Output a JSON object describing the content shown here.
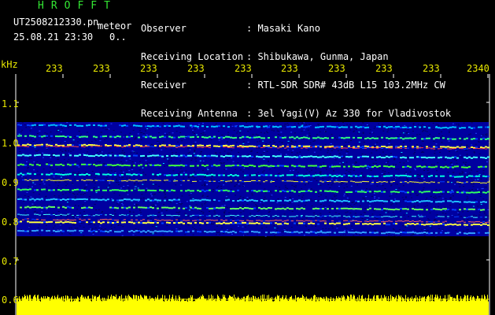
{
  "header": {
    "brand": "HROFFT",
    "filename": "UT2508212330.pn",
    "tag": "meteor",
    "datetime": "25.08.21 23:30",
    "count": "0..",
    "info_labels": [
      "Observer",
      "Receiving Location",
      "Receiver",
      "Receiving Antenna"
    ],
    "info_values": [
      ": Masaki Kano",
      ": Shibukawa, Gunma, Japan",
      ": RTL-SDR SDR# 43dB L15 103.2MHz CW",
      ": 3el Yagi(V) Az 330 for Vladivostok"
    ]
  },
  "axis": {
    "y_unit": "kHz",
    "y_ticks": [
      "1.1",
      "1.0",
      "0.9",
      "0.8",
      "0.7",
      "0.6"
    ],
    "x_ticks": [
      "233",
      "233",
      "233",
      "233",
      "233",
      "233",
      "233",
      "233",
      "233",
      "2340"
    ]
  },
  "colors": {
    "text_main": "#ffffff",
    "brand": "#33e633",
    "axis_label": "#e8e800",
    "background": "#000000",
    "spectrum_base": "#0000a0",
    "signal_floor": "#ffff00"
  }
}
